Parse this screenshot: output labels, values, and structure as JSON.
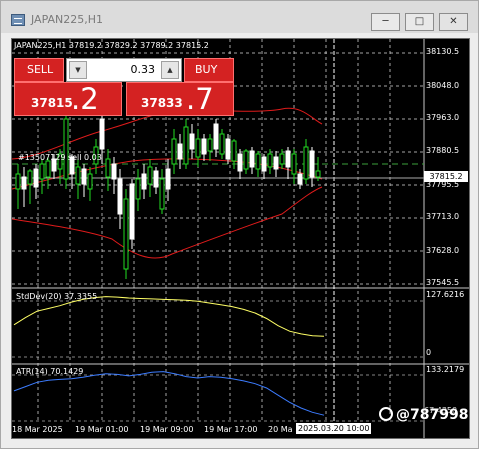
{
  "window": {
    "title": "JAPAN225,H1",
    "buttons": [
      "minimize",
      "maximize",
      "close"
    ]
  },
  "chart": {
    "header": "JAPAN225,H1  37819.2 37829.2 37789.2 37815.2",
    "order_label": "#13507129  sell 0.03",
    "current_price": "37815.2",
    "current_time": "2025.03.20 10:00",
    "price_axis": [
      "38130.5",
      "38048.0",
      "37963.0",
      "37880.5",
      "37795.5",
      "37713.0",
      "37628.0",
      "37545.5"
    ],
    "time_axis": [
      "18 Mar 2025",
      "19 Mar 01:00",
      "19 Mar 09:00",
      "19 Mar 17:00",
      "20 Ma"
    ]
  },
  "trade_panel": {
    "sell_label": "SELL",
    "buy_label": "BUY",
    "lot_value": "0.33",
    "sell_price_small": "37815",
    "sell_price_big": ".2",
    "buy_price_small": "37833",
    "buy_price_big": ".7"
  },
  "indicators": {
    "stddev": {
      "label": "StdDev(20) 37.3355",
      "max": "127.6216",
      "min": "0"
    },
    "atr": {
      "label": "ATR(14) 70.1429",
      "max": "133.2179",
      "min": "67.4350"
    }
  },
  "watermark": "@787998",
  "colors": {
    "background": "#000000",
    "candle_up": "#22dd22",
    "candle_down": "#ffffff",
    "bollinger": "#e01b1b",
    "stddev_line": "#ffff66",
    "atr_line": "#3c7cff",
    "grid": "#dddddd",
    "trade_button": "#d42222"
  },
  "chart_data": {
    "type": "line",
    "series": [
      {
        "name": "StdDev(20)",
        "values": [
          62,
          78,
          92,
          98,
          104,
          112,
          118,
          122,
          124,
          123,
          121,
          120,
          119,
          118,
          117,
          116,
          114,
          110,
          106,
          102,
          96,
          88,
          76,
          60,
          48,
          42,
          38,
          37
        ]
      },
      {
        "name": "ATR(14)",
        "values": [
          104,
          110,
          116,
          119,
          120,
          121,
          123,
          126,
          128,
          127,
          125,
          127,
          130,
          131,
          128,
          124,
          122,
          124,
          123,
          121,
          118,
          114,
          108,
          98,
          88,
          80,
          74,
          70
        ]
      }
    ]
  }
}
